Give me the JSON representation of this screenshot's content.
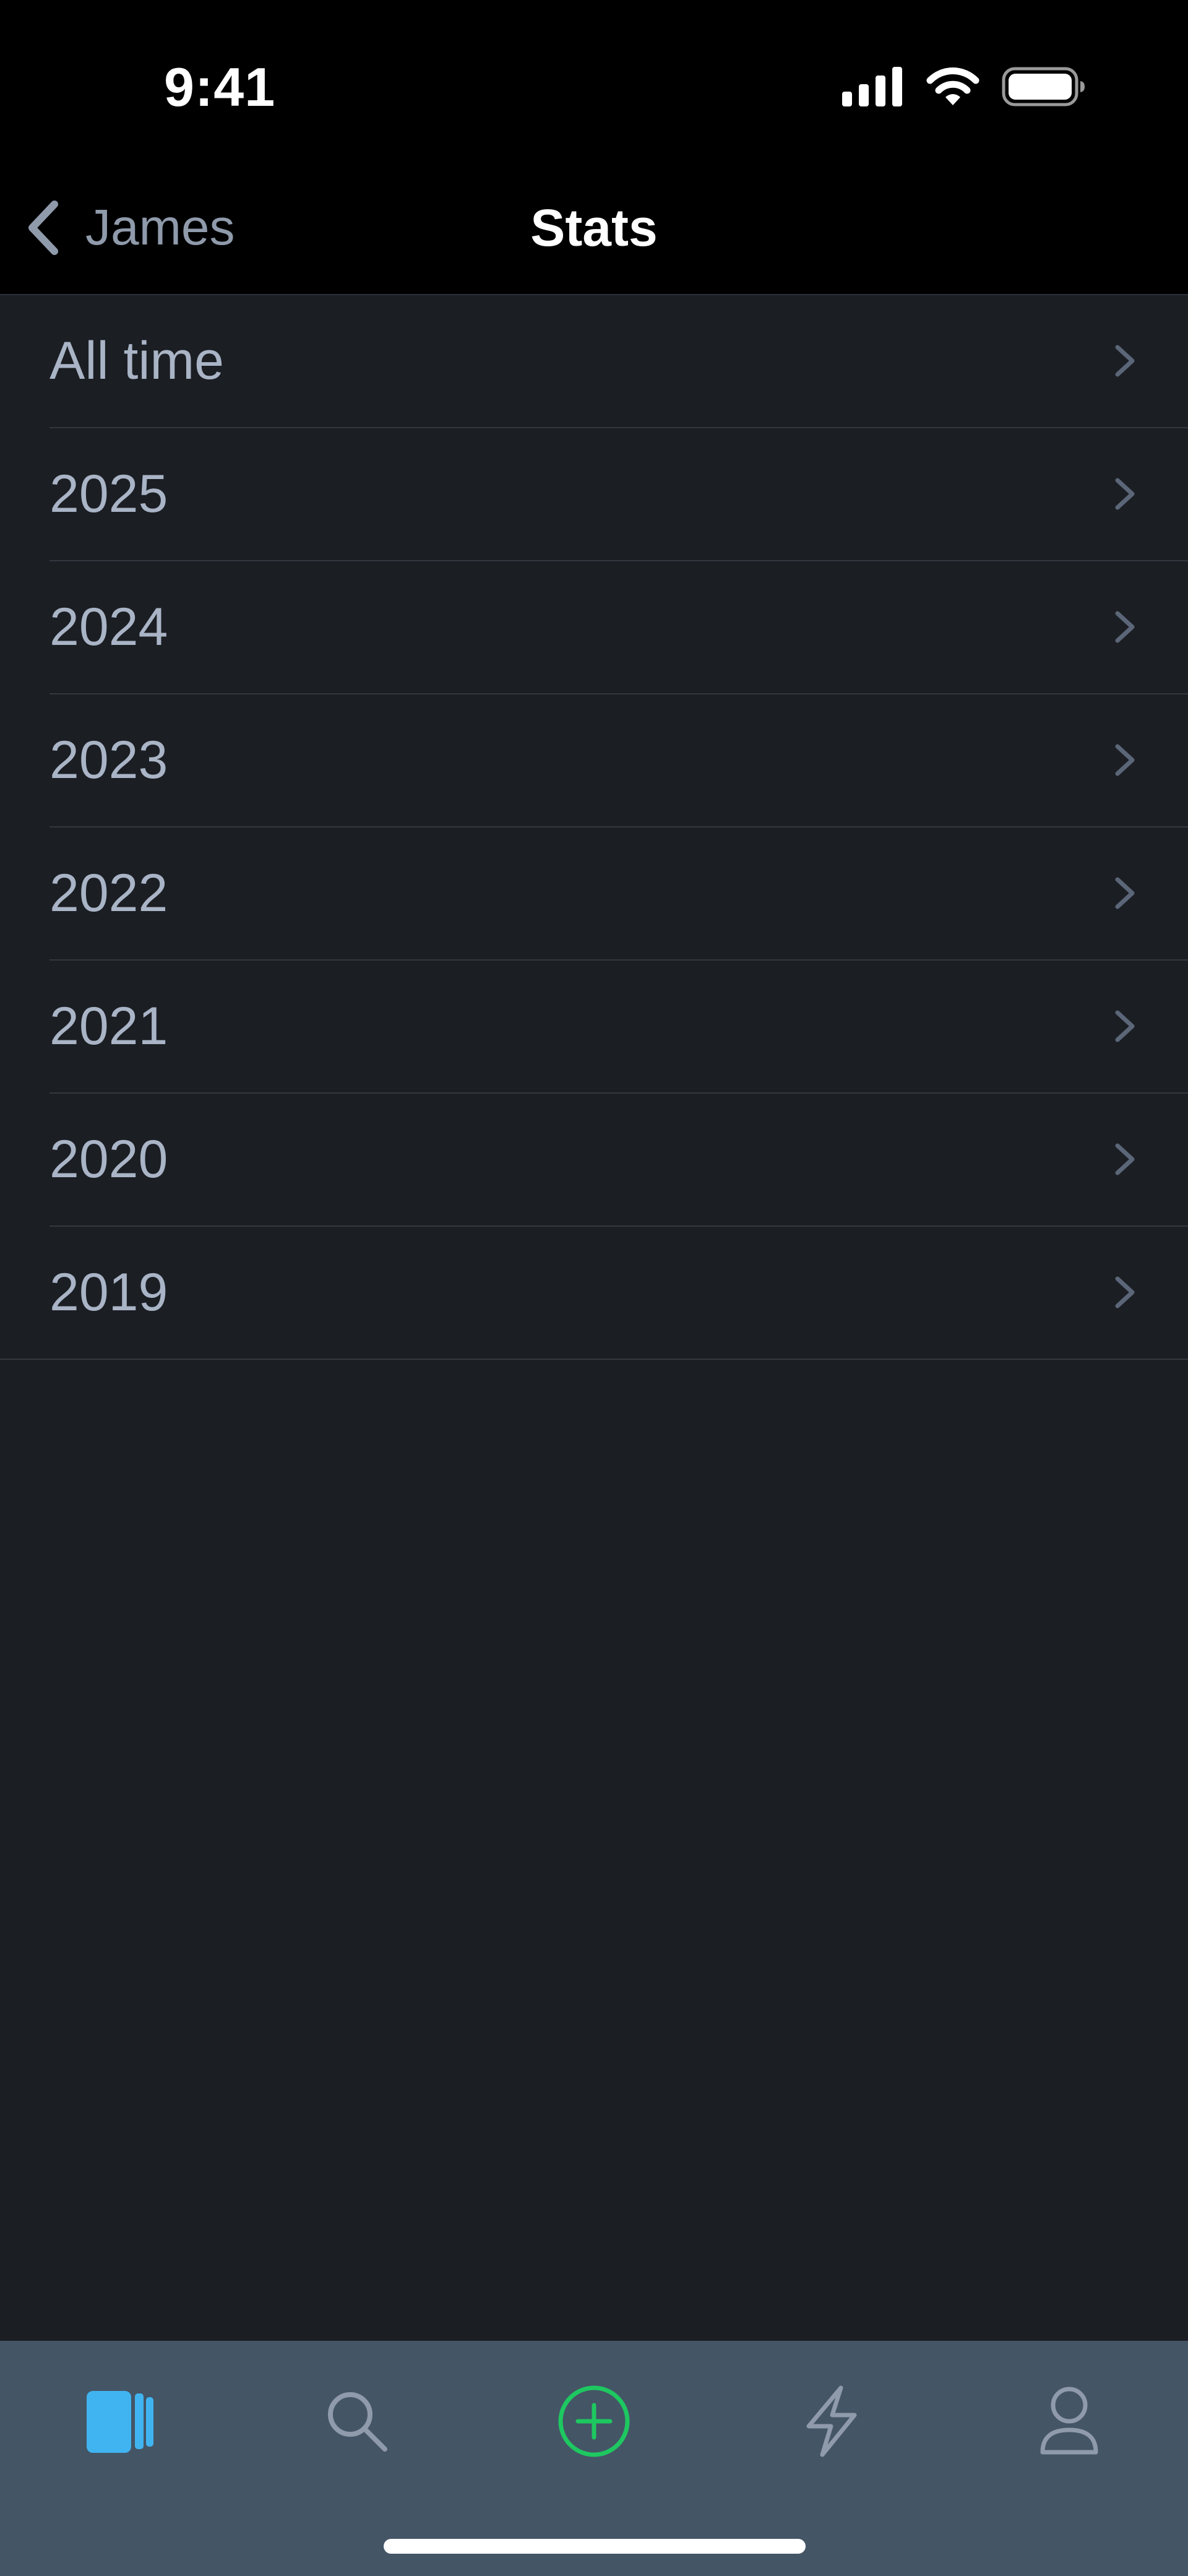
{
  "status_bar": {
    "time": "9:41",
    "icons": [
      "cellular-signal-icon",
      "wifi-icon",
      "battery-icon"
    ]
  },
  "nav": {
    "back_label": "James",
    "title": "Stats"
  },
  "list": {
    "items": [
      {
        "label": "All time"
      },
      {
        "label": "2025"
      },
      {
        "label": "2024"
      },
      {
        "label": "2023"
      },
      {
        "label": "2022"
      },
      {
        "label": "2021"
      },
      {
        "label": "2020"
      },
      {
        "label": "2019"
      }
    ]
  },
  "tabbar": {
    "tabs": [
      {
        "icon": "books-icon",
        "active": true
      },
      {
        "icon": "search-icon",
        "active": false
      },
      {
        "icon": "add-circle-icon",
        "active": false
      },
      {
        "icon": "lightning-icon",
        "active": false
      },
      {
        "icon": "profile-icon",
        "active": false
      }
    ]
  },
  "colors": {
    "background": "#1b1e23",
    "bar_background": "#000000",
    "tabbar_background": "#445566",
    "active_tab": "#40b4f0",
    "add_accent": "#1ec860",
    "row_text": "#a9b4c6",
    "chevron": "#5b6678"
  }
}
